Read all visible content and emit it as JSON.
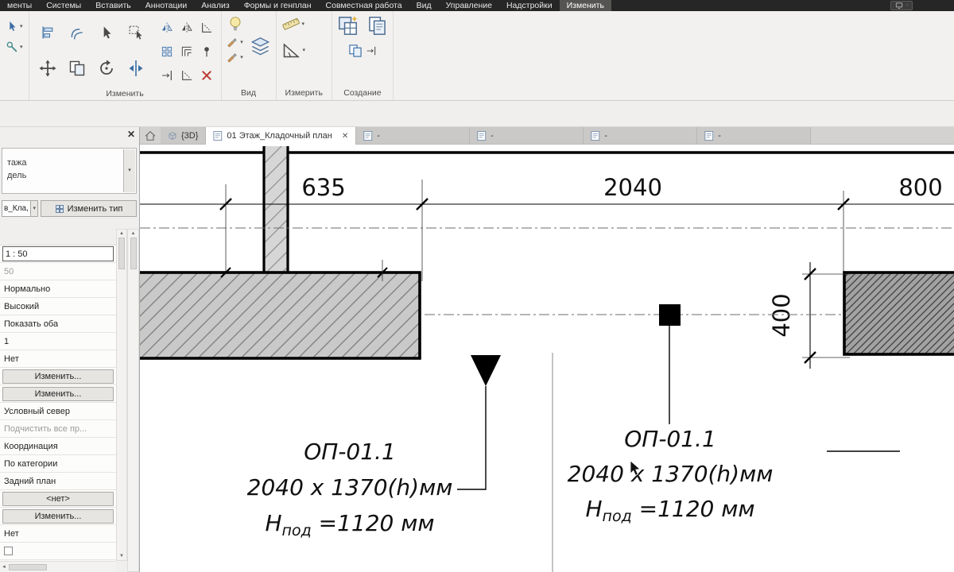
{
  "icons": {
    "caret": "▾",
    "close": "✕",
    "scroll_up": "▲",
    "scroll_down": "▼",
    "scroll_left": "◄"
  },
  "tabbar": {
    "tabs": [
      {
        "label": "менты",
        "active": false
      },
      {
        "label": "Системы",
        "active": false
      },
      {
        "label": "Вставить",
        "active": false
      },
      {
        "label": "Аннотации",
        "active": false
      },
      {
        "label": "Анализ",
        "active": false
      },
      {
        "label": "Формы и генплан",
        "active": false
      },
      {
        "label": "Совместная работа",
        "active": false
      },
      {
        "label": "Вид",
        "active": false
      },
      {
        "label": "Управление",
        "active": false
      },
      {
        "label": "Надстройки",
        "active": false
      },
      {
        "label": "Изменить",
        "active": true
      }
    ]
  },
  "ribbon": {
    "groups": [
      {
        "label": "Изменить"
      },
      {
        "label": "Вид"
      },
      {
        "label": "Измерить"
      },
      {
        "label": "Создание"
      }
    ]
  },
  "view_tabs": {
    "tabs": [
      {
        "label": "{3D}",
        "active": false,
        "closable": false
      },
      {
        "label": "01 Этаж_Кладочный план",
        "active": true,
        "closable": true
      },
      {
        "label": "-",
        "active": false,
        "closable": false
      },
      {
        "label": "-",
        "active": false,
        "closable": false
      },
      {
        "label": "-",
        "active": false,
        "closable": false
      },
      {
        "label": "-",
        "active": false,
        "closable": false
      }
    ]
  },
  "properties_panel": {
    "type_selector": {
      "line1": "тажа",
      "line2": "дель"
    },
    "filter_combo": "в_Кла,",
    "edit_type_button": "Изменить тип",
    "rows": [
      {
        "value": "1 : 50",
        "kind": "input"
      },
      {
        "value": "50",
        "kind": "disabled"
      },
      {
        "value": "Нормально",
        "kind": "value"
      },
      {
        "value": "Высокий",
        "kind": "value"
      },
      {
        "value": "Показать оба",
        "kind": "value"
      },
      {
        "value": "1",
        "kind": "value"
      },
      {
        "value": "Нет",
        "kind": "value"
      },
      {
        "value": "Изменить...",
        "kind": "button"
      },
      {
        "value": "Изменить...",
        "kind": "button"
      },
      {
        "value": "Условный север",
        "kind": "value"
      },
      {
        "value": "Подчистить все пр...",
        "kind": "disabled"
      },
      {
        "value": "Координация",
        "kind": "value"
      },
      {
        "value": "По категории",
        "kind": "value"
      },
      {
        "value": "Задний план",
        "kind": "value"
      },
      {
        "value": "<нет>",
        "kind": "button"
      },
      {
        "value": "Изменить...",
        "kind": "button"
      },
      {
        "value": "Нет",
        "kind": "value"
      },
      {
        "value": "",
        "kind": "checkbox"
      }
    ]
  },
  "drawing": {
    "dim_635": "635",
    "dim_2040": "2040",
    "dim_800": "800",
    "dim_400": "400",
    "tag_left": {
      "title": "ОП-01.1",
      "size": "2040 x 1370(h)мм",
      "head_main": "Н",
      "head_sub": "под",
      "head_rest": " =1120 мм"
    },
    "tag_right": {
      "title": "ОП-01.1",
      "size": "2040 x 1370(h)мм",
      "head_main": "Н",
      "head_sub": "под",
      "head_rest": " =1120 мм"
    }
  }
}
